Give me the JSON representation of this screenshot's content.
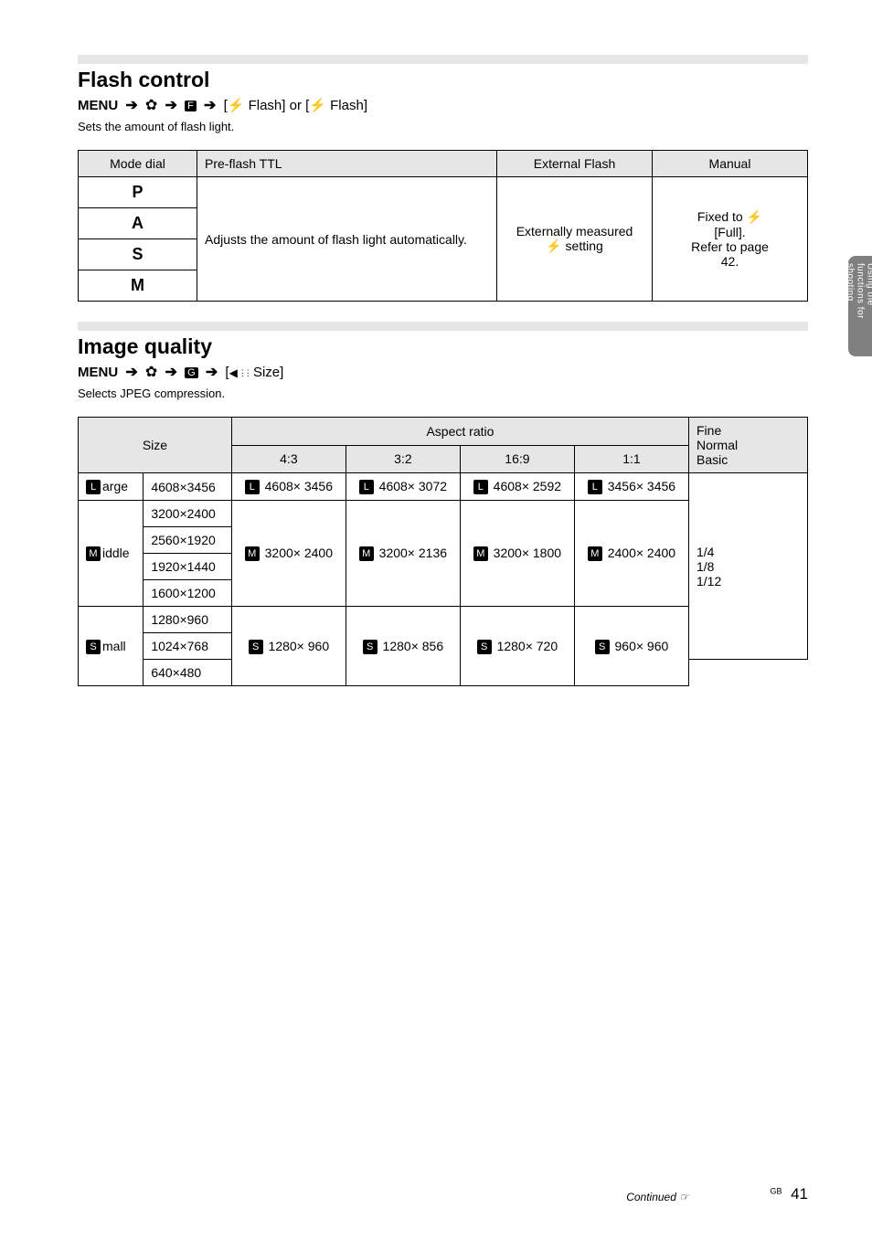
{
  "sideTab": "Using the functions for shooting",
  "section1": {
    "title": "Flash control",
    "breadcrumbPrefix": "MENU",
    "breadcrumbGear": "gear",
    "breadcrumbTab": "F",
    "breadcrumbItem1": "[",
    "breadcrumbItem2": " Flash] or [",
    "breadcrumbItem3": " Flash]",
    "sub": "Sets the amount of flash light.",
    "table": {
      "headers": [
        "Mode dial",
        "Pre-flash TTL",
        "External Flash",
        "Manual"
      ],
      "rows": [
        {
          "dial": "P",
          "pre": "Adjusts the amount of flash light automatically.",
          "ext": "Externally measured",
          "man": "Fixed to "
        },
        {
          "dial": "A",
          "pre": "",
          "ext": " setting",
          "man": "[Full]."
        },
        {
          "dial": "S",
          "pre": "",
          "ext": "",
          "man": "Refer to page"
        },
        {
          "dial": "M",
          "pre": "",
          "ext": "",
          "man": "42."
        }
      ]
    }
  },
  "section2": {
    "title": "Image quality",
    "breadcrumbPrefix": "MENU",
    "breadcrumbTab": "G",
    "breadcrumbItem": "[   Size]",
    "sub": "Selects JPEG compression.",
    "table": {
      "colHeaders": {
        "size": "Size",
        "aspect": "Aspect ratio",
        "fine": "Fine",
        "norm": "Normal",
        "basic": "Basic"
      },
      "subHeaders": {
        "c4_3": "4:3",
        "c3_2": "3:2",
        "c16_9": "16:9",
        "c1_1": "1:1"
      },
      "rows": [
        {
          "sizeIcon": "L",
          "sizeLabel": "arge",
          "px": [
            "4608×3456"
          ],
          "c4_3": "4608× 3456",
          "c3_2": "4608× 3072",
          "c16_9": "4608× 2592",
          "c1_1": "3456× 3456",
          "comp": "1/4"
        },
        {
          "sizeIcon": "M",
          "sizeLabel": "iddle",
          "px": [
            "3200×2400",
            "2560×1920",
            "1920×1440",
            "1600×1200"
          ],
          "c4_3": "3200× 2400",
          "c3_2": "3200× 2136",
          "c16_9": "3200× 1800",
          "c1_1": "2400× 2400",
          "comp": "1/8"
        },
        {
          "sizeIcon": "S",
          "sizeLabel": "mall",
          "px": [
            "1280×960",
            "1024×768",
            "640×480"
          ],
          "c4_3": "1280× 960",
          "c3_2": "1280× 856",
          "c16_9": "1280× 720",
          "c1_1": "960× 960",
          "comp": "1/12"
        }
      ]
    }
  },
  "continued": "Continued ",
  "footer": {
    "label": "GB",
    "page": "41"
  }
}
